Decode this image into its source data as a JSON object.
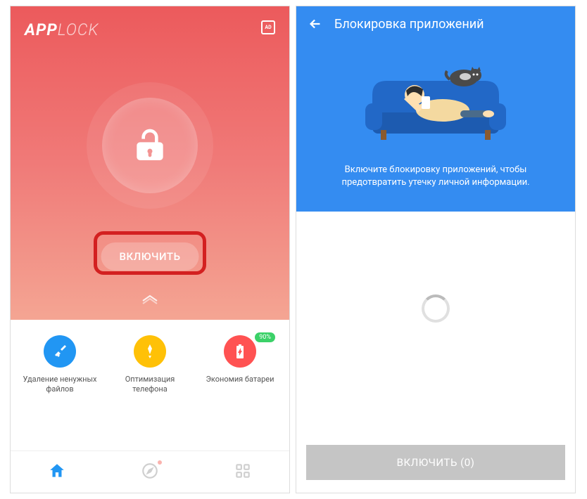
{
  "left": {
    "app_name_bold": "APP",
    "app_name_thin": "LOCK",
    "enable_label": "ВКЛЮЧИТЬ",
    "features": [
      {
        "label": "Удаление ненужных файлов",
        "color": "#2196f3"
      },
      {
        "label": "Оптимизация телефона",
        "color": "#ffc107"
      },
      {
        "label": "Экономия батареи",
        "color": "#ff5252",
        "badge": "90%"
      }
    ]
  },
  "right": {
    "title": "Блокировка приложений",
    "subtitle_line1": "Включите блокировку приложений, чтобы",
    "subtitle_line2": "предотвратить утечку личной информации.",
    "enable_label": "ВКЛЮЧИТЬ (0)"
  }
}
